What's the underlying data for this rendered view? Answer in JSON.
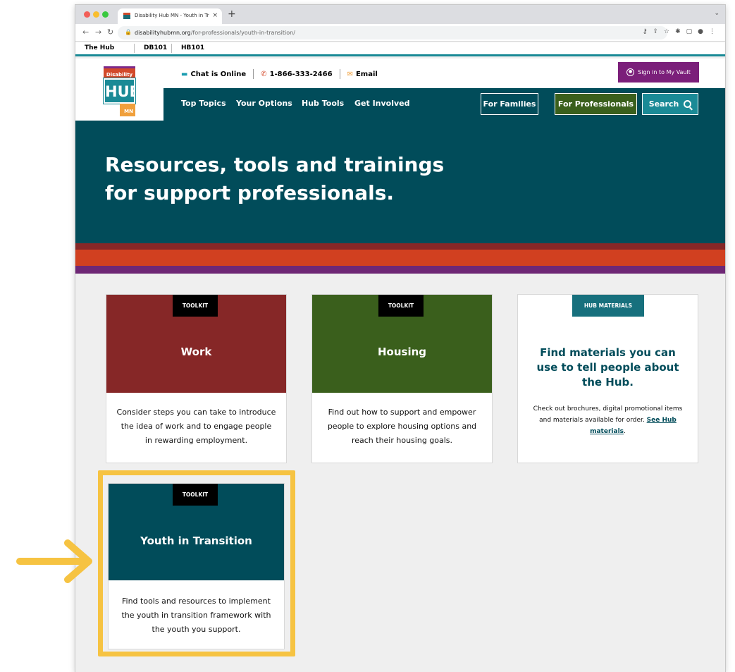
{
  "browser": {
    "tab_title": "Disability Hub MN - Youth in Tr",
    "tab_close": "×",
    "new_tab": "+",
    "url_domain": "disabilityhubmn.org",
    "url_path": "/for-professionals/youth-in-transition/"
  },
  "site_top": {
    "links": [
      "The Hub",
      "DB101",
      "HB101"
    ]
  },
  "logo": {
    "top": "Disability",
    "middle": "HUB",
    "bottom": "MN"
  },
  "utility": {
    "chat": "Chat is Online",
    "phone": "1-866-333-2466",
    "email": "Email",
    "vault": "Sign in to My Vault"
  },
  "nav": {
    "items": [
      "Top Topics",
      "Your Options",
      "Hub Tools",
      "Get Involved"
    ],
    "families": "For Families",
    "professionals": "For Professionals",
    "search": "Search"
  },
  "hero": {
    "line1": "Resources, tools and trainings",
    "line2": "for support professionals."
  },
  "cards": [
    {
      "tag": "TOOLKIT",
      "title": "Work",
      "desc": "Consider steps you can take to introduce the idea of work and to engage people in rewarding employment.",
      "color": "#862727"
    },
    {
      "tag": "TOOLKIT",
      "title": "Housing",
      "desc": "Find out how to support and empower people to explore housing options and reach their housing goals.",
      "color": "#3a5f1c"
    },
    {
      "tag": "HUB MATERIALS",
      "title": "Find materials you can use to tell people about the Hub.",
      "desc": "Check out brochures, digital promotional items and materials available for order.",
      "link": "See Hub materials",
      "period": "."
    },
    {
      "tag": "TOOLKIT",
      "title": "Youth in Transition",
      "desc": "Find tools and resources to implement the youth in transition framework with the youth you support.",
      "color": "#014c5a"
    }
  ],
  "colors": {
    "teal_dark": "#014c5a",
    "teal": "#1a8a96",
    "green": "#3a5f1c",
    "maroon": "#862727",
    "orange": "#d14020",
    "purple": "#6e2775",
    "highlight_yellow": "#f6c342"
  }
}
